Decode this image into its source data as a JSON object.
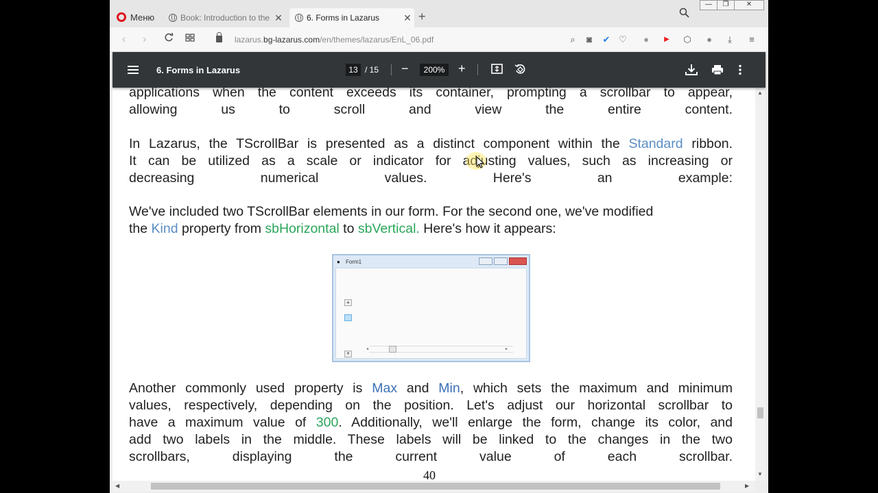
{
  "browser": {
    "menu_label": "Меню",
    "tabs": [
      {
        "title": "Book: Introduction to the L",
        "active": false
      },
      {
        "title": "6. Forms in Lazarus",
        "active": true
      }
    ],
    "new_tab_symbol": "+",
    "close_symbol": "✕",
    "url_host": "lazarus.bg-lazarus.com",
    "url_host_prefix": "lazarus.",
    "url_host_main": "bg-lazarus.com",
    "url_path": "/en/themes/lazarus/EnL_06.pdf",
    "window_controls": [
      "minimize",
      "restore",
      "close"
    ]
  },
  "pdf_toolbar": {
    "doc_title": "6. Forms in Lazarus",
    "current_page": "13",
    "total_pages": "/ 15",
    "zoom": "200%",
    "zoom_out_symbol": "−",
    "zoom_in_symbol": "+"
  },
  "page": {
    "para1": [
      "applications when the content exceeds its container, prompting a scrollbar to appear,",
      "allowing us to scroll and view the entire content."
    ],
    "para2": {
      "l1_a": "In Lazarus, the TScrollBar is presented as a distinct component within the ",
      "l1_b": "Standard",
      "l1_c": " ribbon.",
      "l2": "It can be utilized as a scale or indicator for adjusting values, such as increasing or",
      "l3": "decreasing numerical values. Here's an example:"
    },
    "para3": {
      "l1": "We've included two TScrollBar elements in our form. For the second one, we've modified",
      "l2_a": "the ",
      "l2_b": "Kind",
      "l2_c": " property from ",
      "l2_d": "sbHorizontal",
      "l2_e": " to ",
      "l2_f": "sbVertical.",
      "l2_g": " Here's how it appears:"
    },
    "form_image": {
      "title": "Form1"
    },
    "para4": {
      "l1_a": "Another commonly used property is ",
      "l1_b": "Max",
      "l1_c": " and ",
      "l1_d": "Min",
      "l1_e": ", which sets the maximum and minimum",
      "l2": "values, respectively, depending on the position. Let's adjust our horizontal scrollbar to",
      "l3_a": "have a maximum value of ",
      "l3_b": "300",
      "l3_c": ". Additionally, we'll enlarge the form, change its color, and",
      "l4": "add two labels in the middle. These labels will be linked to the changes in the two",
      "l5": "scrollbars, displaying the current value of each scrollbar."
    },
    "page_number": "40"
  },
  "colors": {
    "pdf_toolbar_bg": "#323639",
    "link_blue": "#3b6fb6",
    "code_green": "#2aa65a",
    "opera_red": "#e0141f"
  }
}
